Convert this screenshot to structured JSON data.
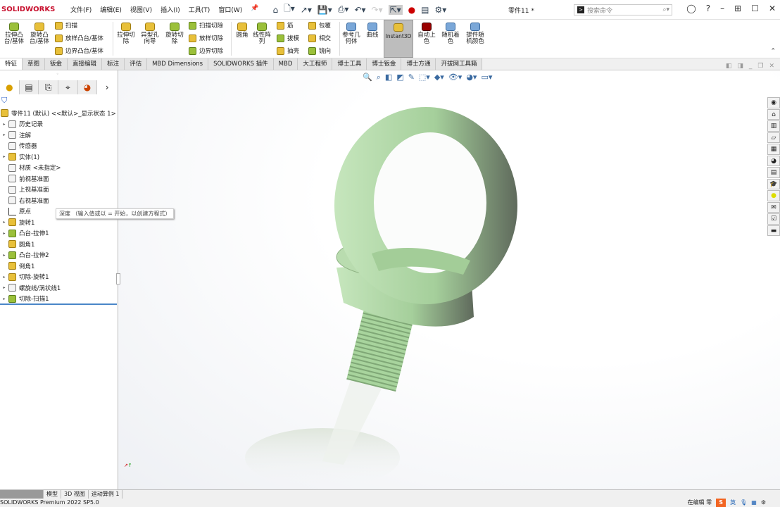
{
  "app": {
    "logo": "SOLIDWORKS",
    "document_title": "零件11 *",
    "search_placeholder": "搜索命令"
  },
  "menu": [
    "文件(F)",
    "编辑(E)",
    "视图(V)",
    "插入(I)",
    "工具(T)",
    "窗口(W)"
  ],
  "ribbon": {
    "large": [
      "拉伸凸台/基体",
      "旋转凸台/基体",
      "拉伸切除",
      "异型孔向导",
      "旋转切除",
      "圆角",
      "线性阵列",
      "参考几何体",
      "曲线",
      "Instant3D",
      "自动上色",
      "随机着色",
      "提件随机颜色"
    ],
    "small": [
      "扫描",
      "放样凸台/基体",
      "边界凸台/基体",
      "扫描切除",
      "放样切除",
      "边界切除",
      "筋",
      "拔模",
      "抽壳",
      "包覆",
      "相交",
      "镜向"
    ]
  },
  "tabs": [
    "特征",
    "草图",
    "钣金",
    "直接编辑",
    "标注",
    "评估",
    "MBD Dimensions",
    "SOLIDWORKS 插件",
    "MBD",
    "大工程师",
    "博士工具",
    "博士钣金",
    "博士方通",
    "开拔网工具箱"
  ],
  "tree": {
    "root": "零件11 (默认) <<默认>_显示状态 1>",
    "items": [
      "历史记录",
      "注解",
      "传感器",
      "实体(1)",
      "材质 <未指定>",
      "前视基准面",
      "上视基准面",
      "右视基准面",
      "原点",
      "旋转1",
      "凸台-拉伸1",
      "圆角1",
      "凸台-拉伸2",
      "倒角1",
      "切除-旋转1",
      "螺旋线/涡状线1",
      "切除-扫描1"
    ]
  },
  "tooltip": "深度 （输入值或以 = 开始，以创建方程式）",
  "bottom_tabs": [
    "模型",
    "3D 视图",
    "运动算例 1"
  ],
  "status": {
    "left": "SOLIDWORKS Premium 2022 SP5.0",
    "right": "在编辑 零",
    "ime": "英"
  },
  "colors": {
    "model": "#a8d4a0",
    "accent": "#c8102e"
  }
}
